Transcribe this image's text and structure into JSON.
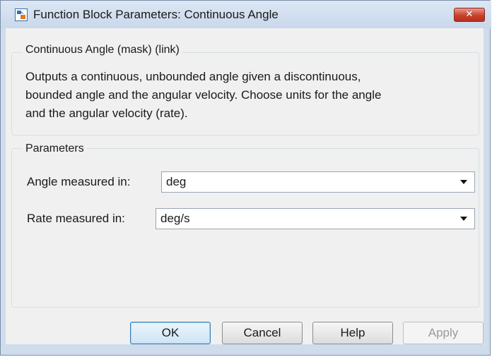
{
  "window": {
    "title": "Function Block Parameters: Continuous Angle",
    "close_icon": "close-icon",
    "app_icon": "simulink-block-icon"
  },
  "description_group": {
    "legend": "Continuous Angle (mask) (link)",
    "lines": [
      "Outputs a continuous, unbounded angle given a discontinuous,",
      "bounded angle and the angular velocity. Choose units for the angle",
      "and the angular velocity (rate)."
    ]
  },
  "parameters_group": {
    "legend": "Parameters",
    "angle": {
      "label": "Angle measured in:",
      "value": "deg"
    },
    "rate": {
      "label": "Rate measured in:",
      "value": "deg/s"
    }
  },
  "buttons": {
    "ok": "OK",
    "cancel": "Cancel",
    "help": "Help",
    "apply": "Apply"
  },
  "colors": {
    "accent": "#3c7fb1",
    "close_button": "#c8412c"
  }
}
